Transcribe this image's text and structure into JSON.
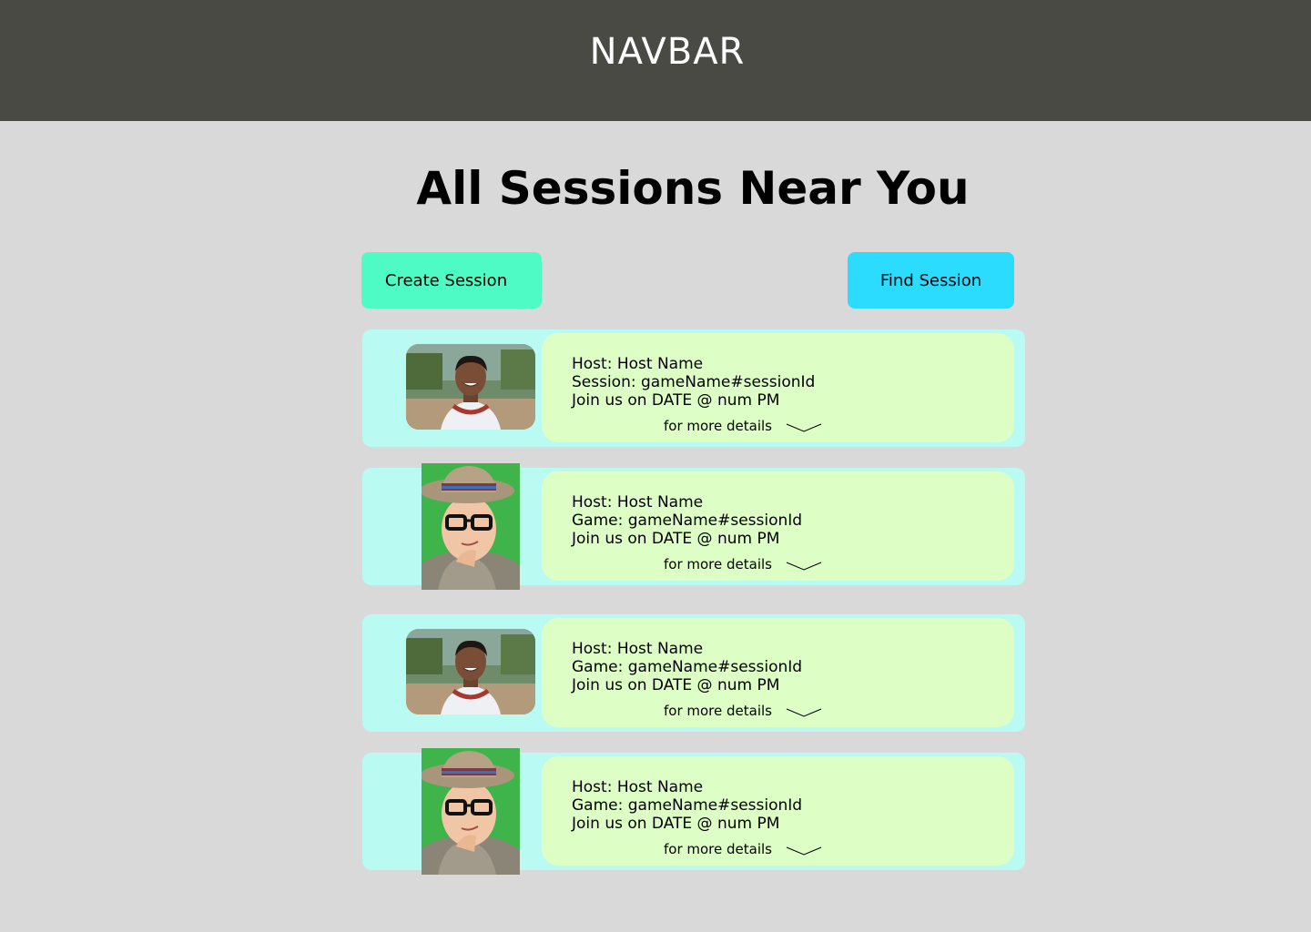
{
  "navbar": {
    "title": "NAVBAR"
  },
  "page": {
    "title": "All Sessions Near You"
  },
  "actions": {
    "create_label": "Create Session",
    "find_label": "Find Session"
  },
  "colors": {
    "navbar_bg": "#4a4a44",
    "page_bg": "#d9d9d9",
    "create_btn": "#4ffbc4",
    "find_btn": "#2bdcfe",
    "card_outer": "#b9fbf3",
    "card_inner": "#ddfec5"
  },
  "sessions": [
    {
      "host": "Host: Host Name",
      "session": "Session: gameName#sessionId",
      "date": "Join us on DATE @ num PM",
      "more": "for more details",
      "avatar": "smiling-person-photo",
      "expand_icon": "chevron-down-icon"
    },
    {
      "host": "Host: Host Name",
      "session": "Game: gameName#sessionId",
      "date": "Join us on DATE @ num PM",
      "more": "for more details",
      "avatar": "person-with-hat-photo",
      "expand_icon": "chevron-down-icon"
    },
    {
      "host": "Host: Host Name",
      "session": "Game: gameName#sessionId",
      "date": "Join us on DATE @ num PM",
      "more": "for more details",
      "avatar": "smiling-person-photo",
      "expand_icon": "chevron-down-icon"
    },
    {
      "host": "Host: Host Name",
      "session": "Game: gameName#sessionId",
      "date": "Join us on DATE @ num PM",
      "more": "for more details",
      "avatar": "person-with-hat-photo",
      "expand_icon": "chevron-down-icon"
    }
  ]
}
